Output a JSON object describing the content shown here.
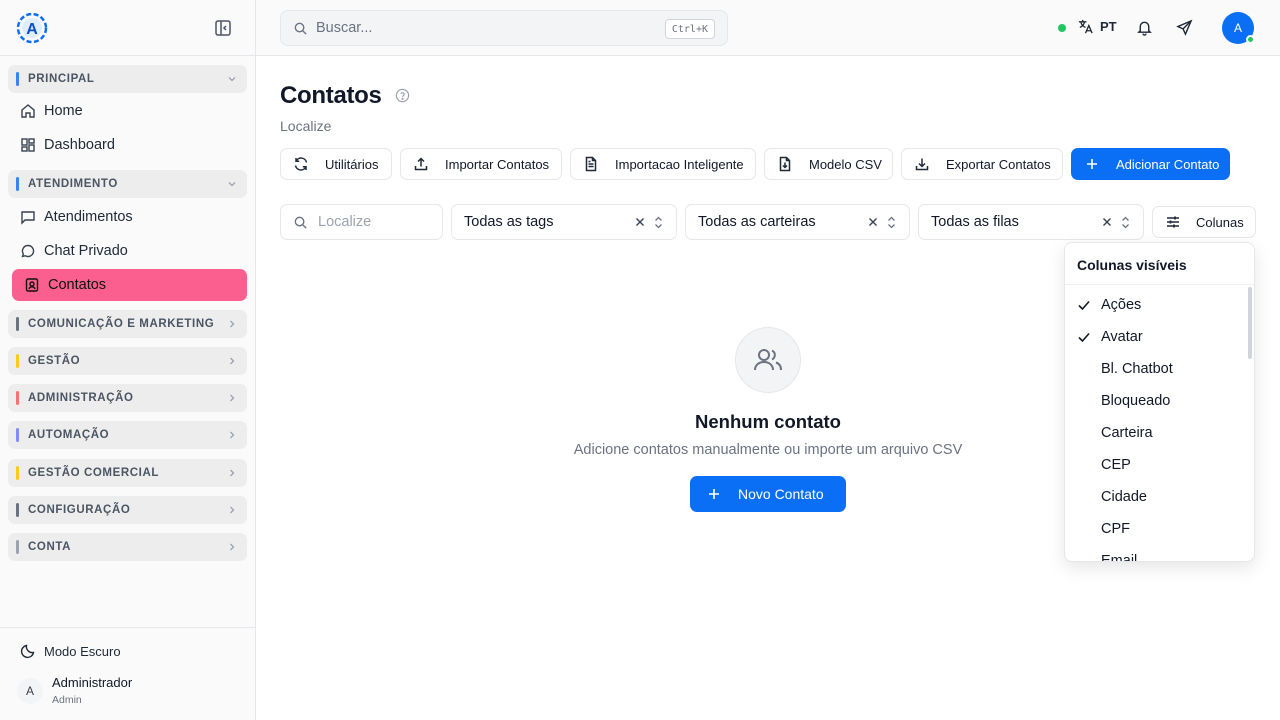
{
  "sidebar": {
    "groups": [
      {
        "label": "PRINCIPAL",
        "color": "#3b82f6"
      },
      {
        "label": "ATENDIMENTO",
        "color": "#3b82f6"
      },
      {
        "label": "COMUNICAÇÃO E MARKETING",
        "color": "#6b7280"
      },
      {
        "label": "GESTÃO",
        "color": "#facc15"
      },
      {
        "label": "ADMINISTRAÇÃO",
        "color": "#f87171"
      },
      {
        "label": "AUTOMAÇÃO",
        "color": "#818cf8"
      },
      {
        "label": "GESTÃO COMERCIAL",
        "color": "#facc15"
      },
      {
        "label": "CONFIGURAÇÃO",
        "color": "#6b7280"
      },
      {
        "label": "CONTA",
        "color": "#9ca3af"
      }
    ],
    "items": {
      "home": "Home",
      "dashboard": "Dashboard",
      "atendimentos": "Atendimentos",
      "chat_privado": "Chat Privado",
      "contatos": "Contatos"
    },
    "dark_mode": "Modo Escuro",
    "user": {
      "initial": "A",
      "name": "Administrador",
      "role": "Admin"
    }
  },
  "topbar": {
    "search_placeholder": "Buscar...",
    "shortcut": "Ctrl+K",
    "language": "PT",
    "avatar_initial": "A"
  },
  "page": {
    "title": "Contatos",
    "subtitle": "Localize",
    "actions": {
      "utilitarios": "Utilitários",
      "importar": "Importar Contatos",
      "importacao_inteligente": "Importacao Inteligente",
      "modelo_csv": "Modelo CSV",
      "exportar": "Exportar Contatos",
      "adicionar": "Adicionar Contato"
    },
    "filters": {
      "search_placeholder": "Localize",
      "tags": "Todas as tags",
      "carteiras": "Todas as carteiras",
      "filas": "Todas as filas",
      "colunas": "Colunas"
    },
    "empty": {
      "title": "Nenhum contato",
      "description": "Adicione contatos manualmente ou importe um arquivo CSV",
      "button": "Novo Contato"
    }
  },
  "columns_menu": {
    "title": "Colunas visíveis",
    "items": [
      {
        "label": "Ações",
        "checked": true
      },
      {
        "label": "Avatar",
        "checked": true
      },
      {
        "label": "Bl. Chatbot",
        "checked": false
      },
      {
        "label": "Bloqueado",
        "checked": false
      },
      {
        "label": "Carteira",
        "checked": false
      },
      {
        "label": "CEP",
        "checked": false
      },
      {
        "label": "Cidade",
        "checked": false
      },
      {
        "label": "CPF",
        "checked": false
      },
      {
        "label": "Email",
        "checked": false
      }
    ]
  },
  "colors": {
    "primary": "#0a6ff5",
    "active_nav": "#fb5f8f",
    "online": "#22c55e"
  }
}
